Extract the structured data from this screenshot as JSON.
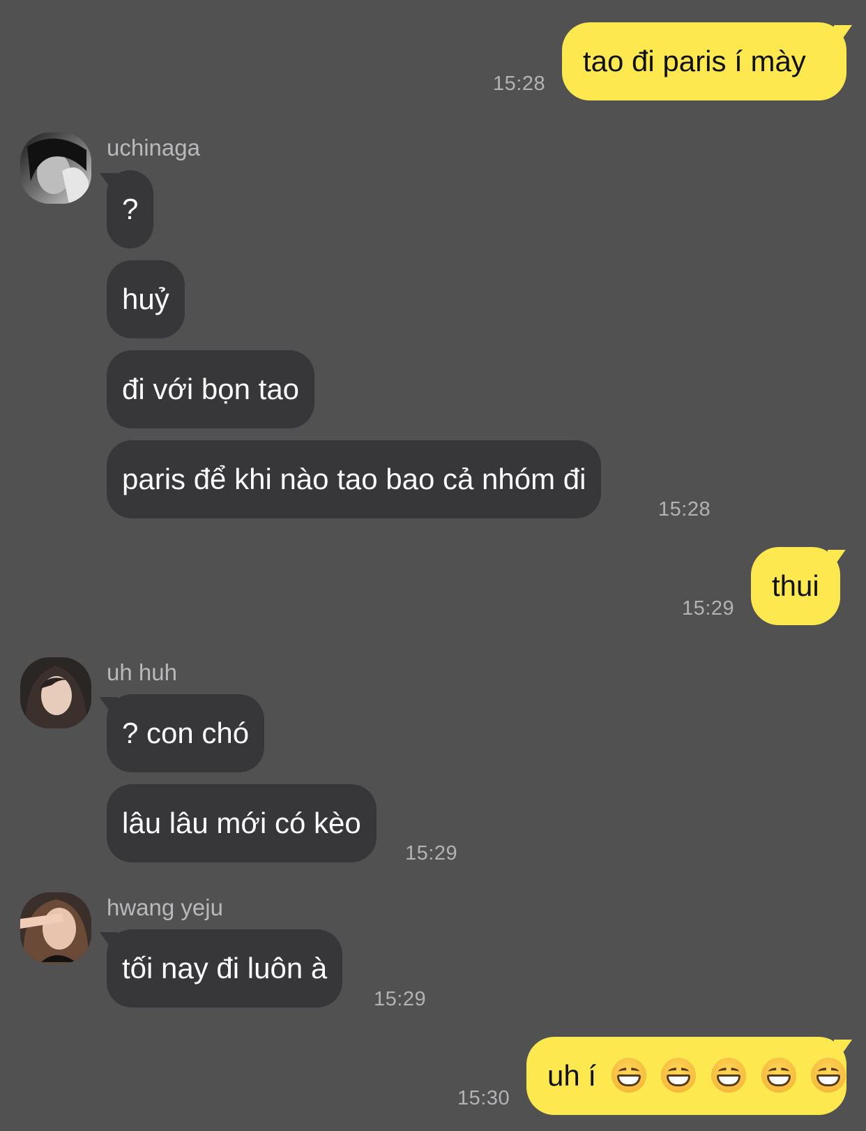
{
  "messages": {
    "m1": {
      "text": "tao đi paris í mày",
      "time": "15:28"
    },
    "sender1": {
      "name": "uchinaga"
    },
    "m2": {
      "text": "?"
    },
    "m3": {
      "text": "huỷ"
    },
    "m4": {
      "text": "đi với bọn tao"
    },
    "m5": {
      "text": "paris để khi nào tao bao cả nhóm đi",
      "time": "15:28"
    },
    "m6": {
      "text": "thui",
      "time": "15:29"
    },
    "sender2": {
      "name": "uh huh"
    },
    "m7": {
      "text": "? con chó"
    },
    "m8": {
      "text": "lâu lâu mới có kèo",
      "time": "15:29"
    },
    "sender3": {
      "name": "hwang yeju"
    },
    "m9": {
      "text": "tối nay đi luôn à",
      "time": "15:29"
    },
    "m10": {
      "text": "uh í",
      "emojis": [
        "grinning-face-emoji",
        "grinning-face-emoji",
        "grinning-face-emoji",
        "grinning-face-emoji",
        "grinning-face-emoji"
      ],
      "time": "15:30"
    }
  },
  "colors": {
    "background": "#525152",
    "outgoing_bubble": "#fde94f",
    "incoming_bubble": "#373638",
    "timestamp": "#b3b2b4"
  }
}
